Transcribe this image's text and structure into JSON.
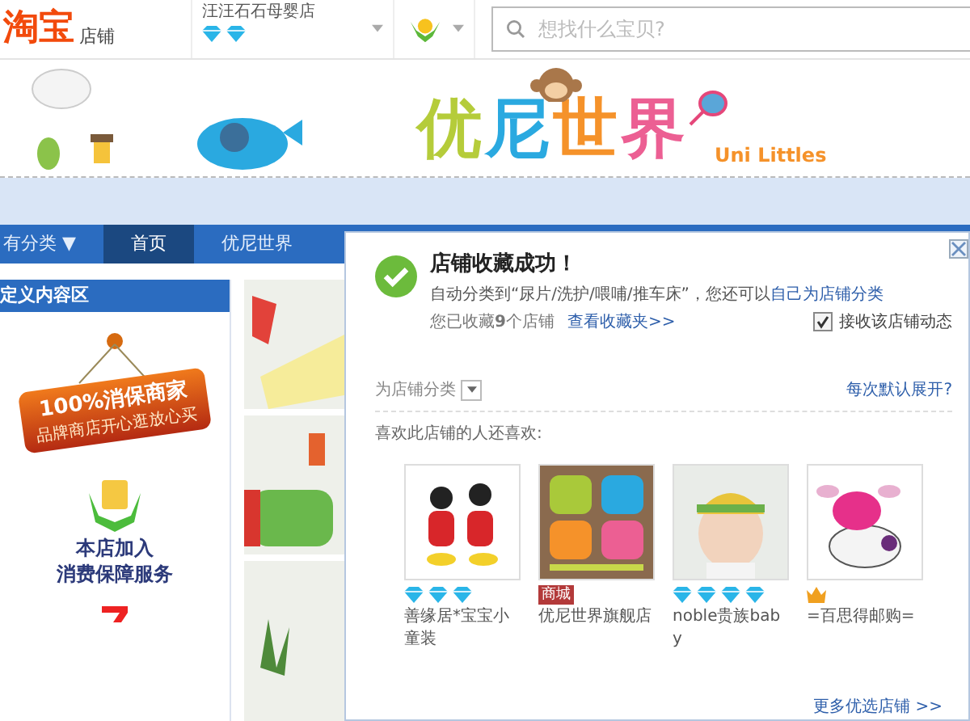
{
  "header": {
    "logo": "淘宝",
    "logo_suffix": "店铺",
    "seller": "汪汪石石母婴店",
    "seller_rating": [
      {
        "kind": "diamond"
      },
      {
        "kind": "diamond"
      }
    ],
    "search": {
      "placeholder": "想找什么宝贝?"
    }
  },
  "banner": {
    "logo_title": "优尼世界",
    "logo_subtitle": "Uni Littles"
  },
  "nav": [
    {
      "label": "有分类 ▼",
      "selected": false
    },
    {
      "label": "首页",
      "selected": true
    },
    {
      "label": "优尼世界",
      "selected": false
    }
  ],
  "sidebar": {
    "title": "定义内容区",
    "sign_title": "100%消保商家",
    "sign_subtitle": "品牌商店开心逛放心买",
    "guarantee": [
      "本店加入",
      "消费保障服务"
    ]
  },
  "popup": {
    "title": "店铺收藏成功！",
    "message": "自动分类到“尿片/洗护/喂哺/推车床”，您还可以",
    "message_link": "自己为店铺分类",
    "count_text": "您已收藏**9**个店铺",
    "favorites_link": "查看收藏夹>>",
    "subscribe": {
      "label": "接收该店铺动态",
      "checked": true
    },
    "category_label": "为店铺分类",
    "expand_link": "每次默认展开?",
    "also_like": "喜欢此店铺的人还喜欢:",
    "shops": [
      {
        "name": "善缘居*宝宝小童装",
        "badges": [
          {
            "kind": "diamond"
          },
          {
            "kind": "diamond"
          },
          {
            "kind": "diamond"
          }
        ]
      },
      {
        "name": "优尼世界旗舰店",
        "badges": [
          {
            "kind": "tag",
            "text": "商城"
          }
        ]
      },
      {
        "name": "noble贵族baby",
        "badges": [
          {
            "kind": "diamond"
          },
          {
            "kind": "diamond"
          },
          {
            "kind": "diamond"
          },
          {
            "kind": "diamond"
          }
        ]
      },
      {
        "name": "=百思得邮购=",
        "badges": [
          {
            "kind": "crown"
          }
        ]
      }
    ],
    "more_link": "更多优选店铺 >>"
  }
}
